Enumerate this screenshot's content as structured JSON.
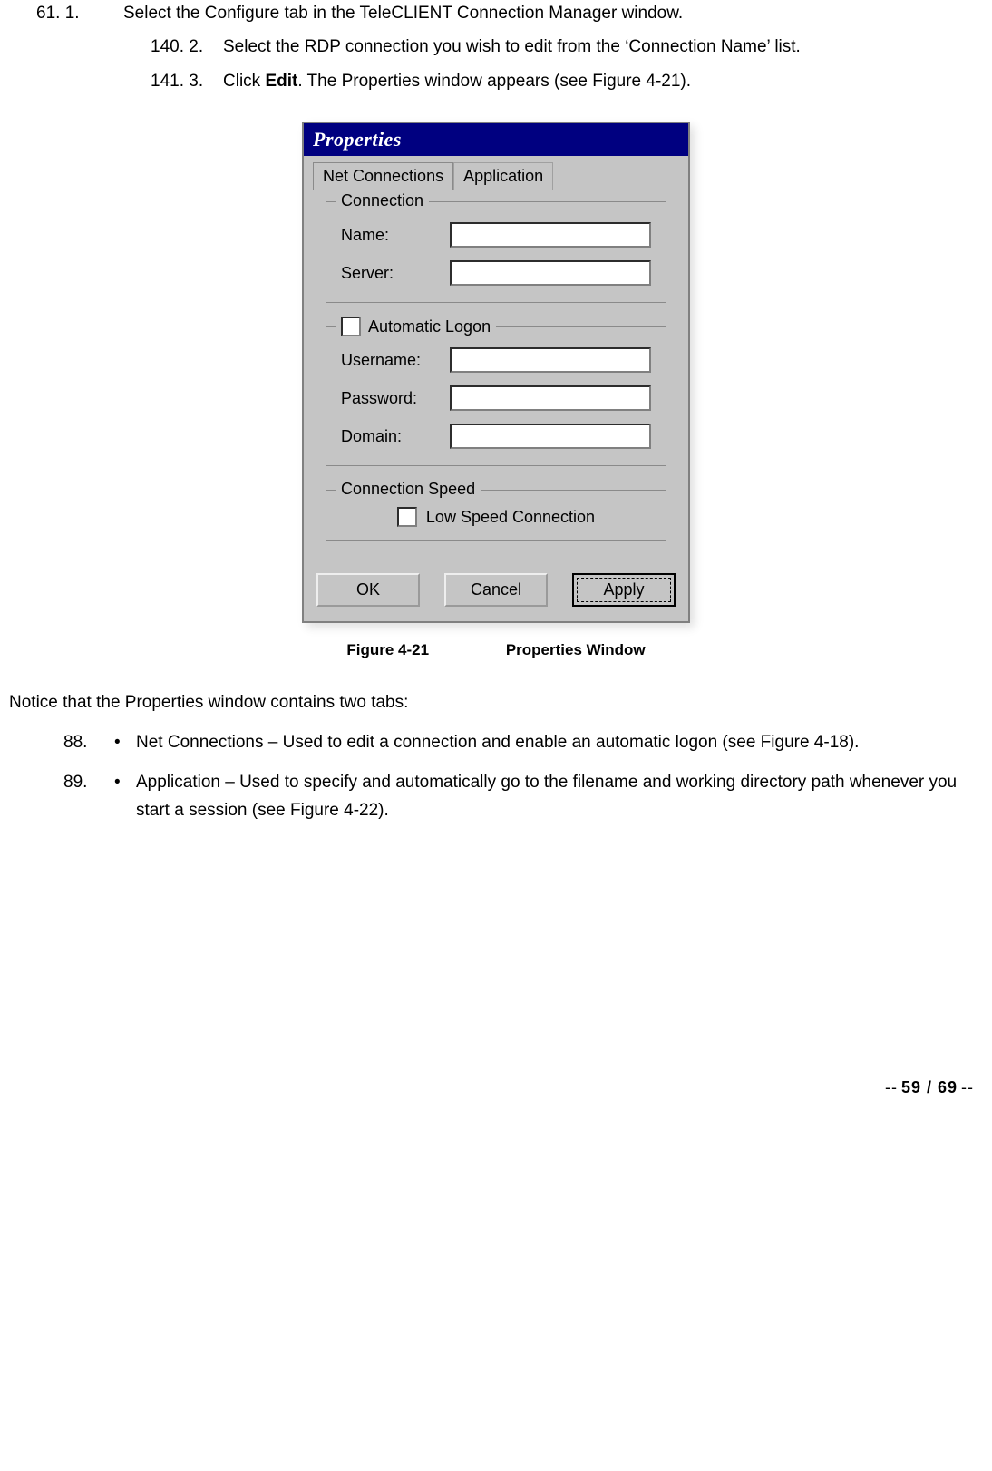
{
  "steps": {
    "s1_num": "61. 1.",
    "s1_text": "Select the Configure tab in the TeleCLIENT Connection Manager window.",
    "s2_num": "140. 2.",
    "s2_text": "Select the RDP connection you wish to edit from the ‘Connection Name’ list.",
    "s3_num": "141. 3.",
    "s3_text_prefix": "Click ",
    "s3_text_bold": "Edit",
    "s3_text_suffix": ". The Properties window appears (see Figure 4-21)."
  },
  "properties_window": {
    "title": "Properties",
    "tabs": {
      "net": "Net Connections",
      "app": "Application"
    },
    "group_connection": {
      "legend": "Connection",
      "name_label": "Name:",
      "server_label": "Server:"
    },
    "group_logon": {
      "legend": "Automatic Logon",
      "username_label": "Username:",
      "password_label": "Password:",
      "domain_label": "Domain:"
    },
    "group_speed": {
      "legend": "Connection Speed",
      "low_speed_label": "Low Speed Connection"
    },
    "buttons": {
      "ok": "OK",
      "cancel": "Cancel",
      "apply": "Apply"
    }
  },
  "figure_caption": {
    "num": "Figure 4-21",
    "title": "Properties Window"
  },
  "notice": "Notice that the Properties window contains two tabs:",
  "bullets": {
    "b1_num": "88.",
    "b1_dot": "•",
    "b1_text": "Net Connections  – Used to edit a connection and enable an automatic logon (see Figure 4-18).",
    "b2_num": "89.",
    "b2_dot": "•",
    "b2_text": "Application – Used to specify and automatically go to the filename and working directory path whenever you start a session (see Figure 4-22)."
  },
  "page_number": {
    "left_dash": "--",
    "value": "59 / 69",
    "right_dash": "--"
  }
}
